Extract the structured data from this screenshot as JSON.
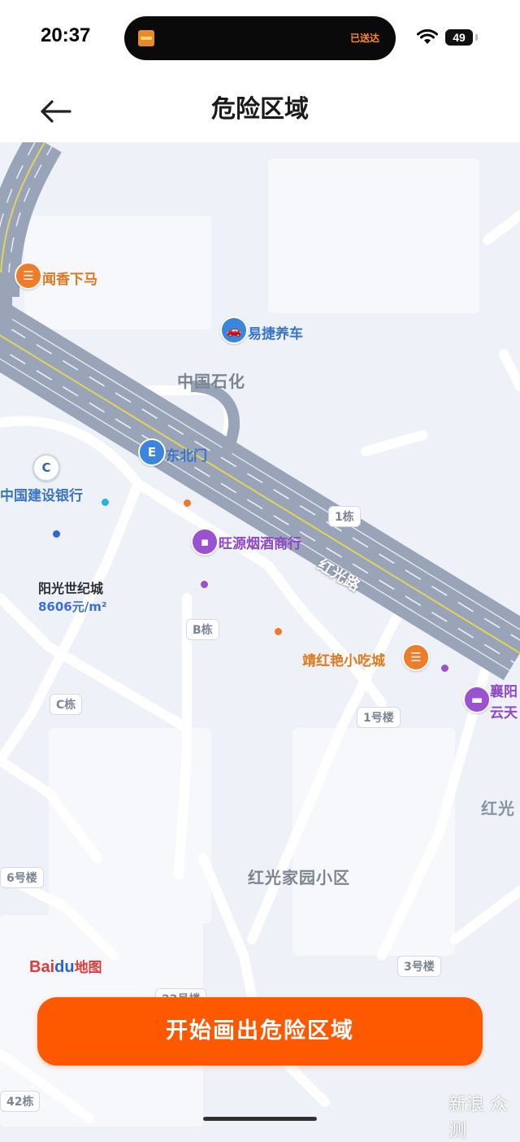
{
  "status_bar": {
    "time": "20:37",
    "island_text": "已送达",
    "battery": "49"
  },
  "navbar": {
    "title": "危险区域",
    "back_icon": "arrow-left-icon"
  },
  "map": {
    "provider_logo": {
      "part1": "Bai",
      "part2": "du",
      "part3": "地图"
    },
    "area_labels": {
      "sinopec": "中国石化",
      "community": "红光家园小区",
      "road_main": "红光路",
      "road_right": "红光"
    },
    "pois": {
      "wenxiang": "闻香下马",
      "yijie": "易捷养车",
      "dongbeimen": "东北门",
      "ccb": "中国建设银行",
      "wangyuan": "旺源烟酒商行",
      "yangguang": "阳光世纪城",
      "yangguang_price": "8606元/m²",
      "jinghong": "靖红艳小吃城",
      "xiangyang_1": "襄阳",
      "xiangyang_2": "云天"
    },
    "buildings": {
      "b1": "1栋",
      "bb": "B栋",
      "bc": "C栋",
      "b1hao": "1号楼",
      "b6hao": "6号楼",
      "b3hao": "3号楼",
      "b42": "42栋",
      "b22": "22号楼"
    }
  },
  "cta": {
    "label": "开始画出危险区域"
  },
  "watermark": "新浪 众测",
  "colors": {
    "accent": "#fe5800",
    "road": "#a2abbe",
    "map_bg": "#eef2f8",
    "poi_orange": "#e2771b",
    "poi_blue": "#3a74c7",
    "poi_purple": "#8e47c9"
  }
}
